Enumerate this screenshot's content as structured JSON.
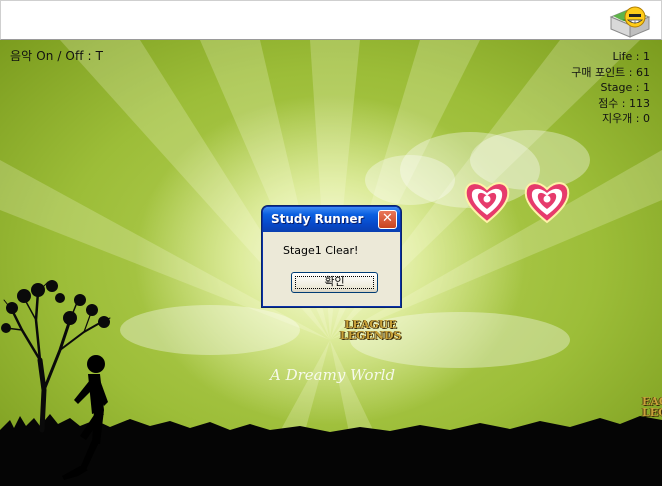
{
  "hud": {
    "music": "음악 On / Off : T",
    "life": "Life : 1",
    "purchase_points": "구매 포인트 : 61",
    "stage": "Stage : 1",
    "score": "점수 : 113",
    "eraser": "지우개 : 0"
  },
  "logos": {
    "lol_center_line1": "LEAGUE",
    "lol_center_line2": "LEGENDS",
    "lol_edge_line1": "EAGUE",
    "lol_edge_line2": "LEGEN",
    "dreamy": "A Dreamy World"
  },
  "dialog": {
    "title": "Study Runner",
    "close": "✕",
    "message": "Stage1 Clear!",
    "ok_label": "확인"
  },
  "icons": {
    "app": "smiley-cube-icon",
    "hearts": [
      "heart-target-icon",
      "heart-target-icon"
    ]
  },
  "colors": {
    "background": "#9cbd38",
    "title_bar": "#0748c8"
  }
}
